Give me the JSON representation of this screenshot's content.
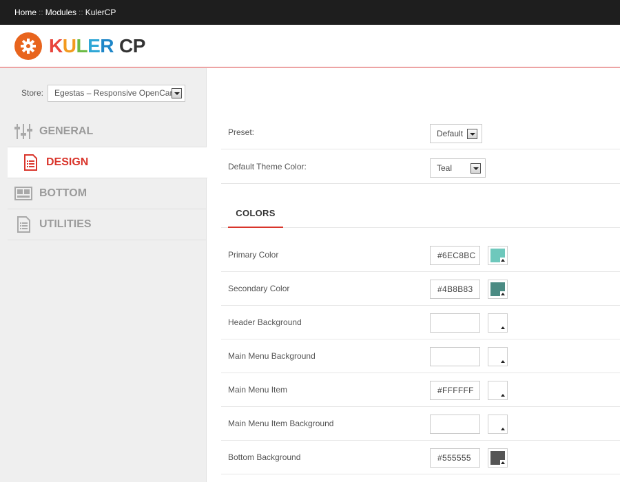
{
  "breadcrumb": {
    "items": [
      "Home",
      "Modules",
      "KulerCP"
    ],
    "separator": "::"
  },
  "logo": {
    "letters": [
      "K",
      "U",
      "L",
      "E",
      "R"
    ],
    "suffix": "CP",
    "badge_color": "#E8641D"
  },
  "sidebar": {
    "store_label": "Store:",
    "store_value": "Egestas – Responsive OpenCart",
    "items": [
      {
        "label": "GENERAL",
        "icon": "sliders-icon",
        "active": false
      },
      {
        "label": "DESIGN",
        "icon": "document-icon",
        "active": true
      },
      {
        "label": "BOTTOM",
        "icon": "layout-icon",
        "active": false
      },
      {
        "label": "UTILITIES",
        "icon": "list-document-icon",
        "active": false
      }
    ]
  },
  "settings": {
    "preset_label": "Preset:",
    "preset_value": "Default",
    "theme_color_label": "Default Theme Color:",
    "theme_color_value": "Teal"
  },
  "colors_tab": "COLORS",
  "colors": [
    {
      "label": "Primary Color",
      "value": "#6EC8BC",
      "swatch": "#6EC8BC"
    },
    {
      "label": "Secondary Color",
      "value": "#4B8B83",
      "swatch": "#4B8B83"
    },
    {
      "label": "Header Background",
      "value": "",
      "swatch": ""
    },
    {
      "label": "Main Menu Background",
      "value": "",
      "swatch": ""
    },
    {
      "label": "Main Menu Item",
      "value": "#FFFFFF",
      "swatch": ""
    },
    {
      "label": "Main Menu Item Background",
      "value": "",
      "swatch": ""
    },
    {
      "label": "Bottom Background",
      "value": "#555555",
      "swatch": "#555555"
    }
  ],
  "accent_color": "#D9352B"
}
